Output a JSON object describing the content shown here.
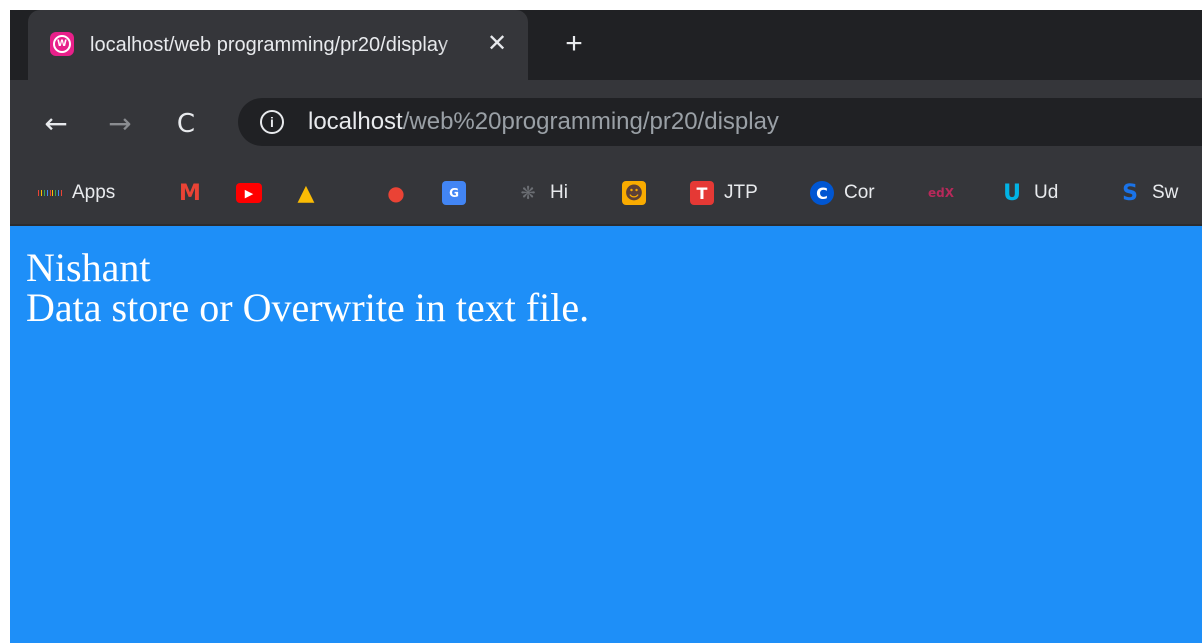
{
  "tab": {
    "title": "localhost/web programming/pr20/display",
    "favicon": "wamp-icon",
    "close_glyph": "✕"
  },
  "newtab_glyph": "+",
  "toolbar": {
    "back_glyph": "←",
    "forward_glyph": "→",
    "reload_glyph": "C",
    "info_glyph": "i",
    "url_host": "localhost",
    "url_path": "/web%20programming/pr20/display"
  },
  "bookmarks": [
    {
      "label": "Apps",
      "icon": "apps-grid-icon"
    },
    {
      "label": "",
      "icon": "gmail-icon",
      "glyph": "M",
      "color": "#ea4335"
    },
    {
      "label": "",
      "icon": "youtube-icon",
      "glyph": "▶",
      "color": "#ff0000"
    },
    {
      "label": "",
      "icon": "drive-icon",
      "glyph": "▲",
      "color": "#1fa463"
    },
    {
      "label": "",
      "icon": "maps-icon",
      "glyph": "●",
      "color": "#34a853"
    },
    {
      "label": "",
      "icon": "translate-icon",
      "glyph": "G",
      "color": "#4285f4"
    },
    {
      "label": "Hi",
      "icon": "bug-icon",
      "glyph": "❋",
      "color": "#5f6368"
    },
    {
      "label": "",
      "icon": "avatar-bookmark-icon",
      "glyph": "☻",
      "color": "#f9ab00"
    },
    {
      "label": "JTP",
      "icon": "jtp-icon",
      "glyph": "T",
      "color": "#e53935"
    },
    {
      "label": "Cor",
      "icon": "coursera-icon",
      "glyph": "C",
      "color": "#0056d2"
    },
    {
      "label": "",
      "icon": "edx-icon",
      "glyph": "edX",
      "color": "#b7295a"
    },
    {
      "label": "Ud",
      "icon": "udacity-icon",
      "glyph": "U",
      "color": "#02b3e4"
    },
    {
      "label": "Sw",
      "icon": "swayam-icon",
      "glyph": "S",
      "color": "#1a73e8"
    }
  ],
  "page": {
    "line1": "Nishant",
    "line2": "Data store or Overwrite in text file.",
    "background": "#1e8ff8"
  }
}
